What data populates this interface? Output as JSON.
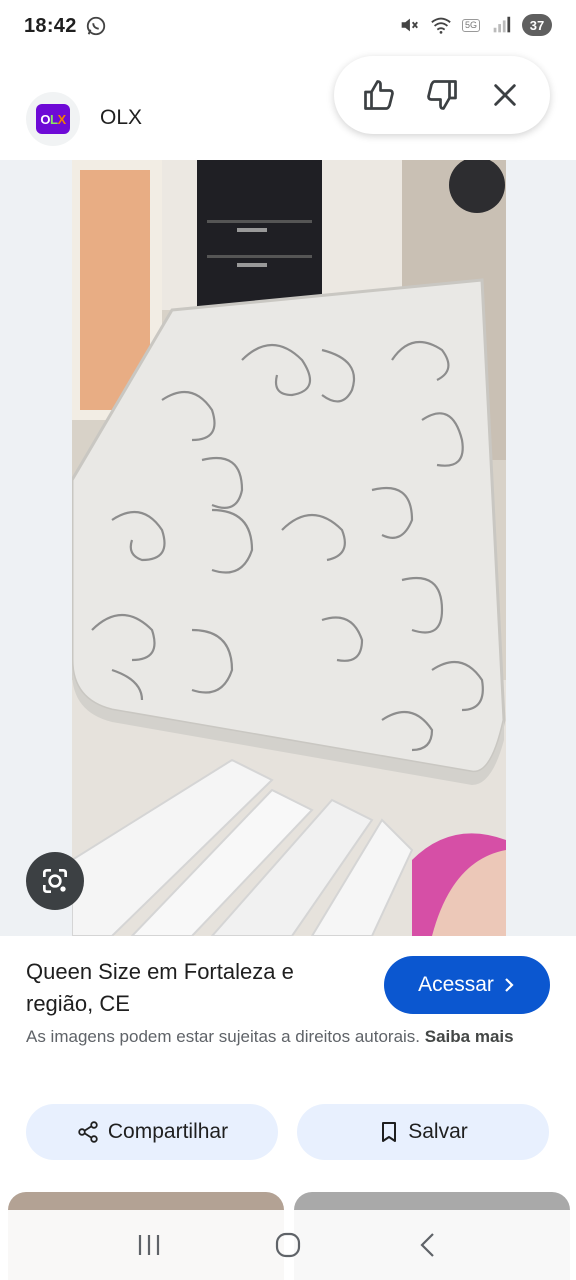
{
  "status_bar": {
    "time": "18:42",
    "network": "5G",
    "battery": "37"
  },
  "header": {
    "site_name": "OLX",
    "logo_text": "OLX"
  },
  "feedback": {
    "like_icon": "thumbs-up-icon",
    "dislike_icon": "thumbs-down-icon",
    "close_icon": "close-icon"
  },
  "result": {
    "title": "Queen Size em Fortaleza e região, CE",
    "visit_label": "Acessar",
    "copyright_text": "As imagens podem estar sujeitas a direitos autorais.",
    "learn_more": "Saiba mais",
    "share_label": "Compartilhar",
    "save_label": "Salvar"
  },
  "colors": {
    "accent": "#0b57d0",
    "tonal_button": "#e8f0fe",
    "olx_purple": "#6e0ad6"
  }
}
